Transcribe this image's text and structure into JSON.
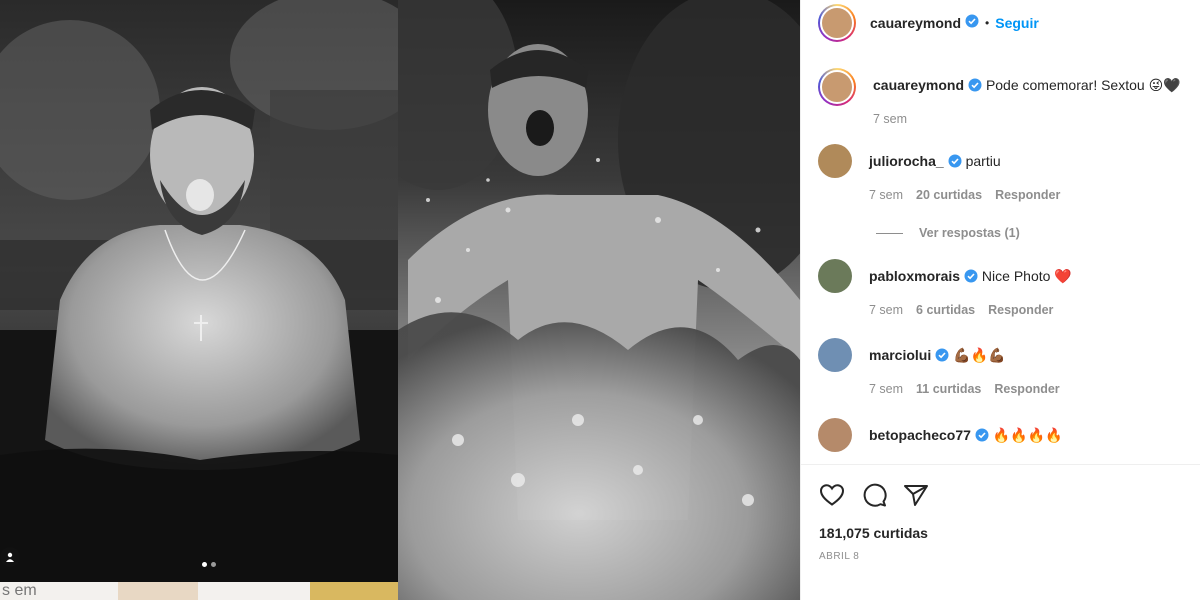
{
  "post": {
    "author": "cauareymond",
    "follow_label": "Seguir",
    "separator": "•",
    "carousel_active_index": 0,
    "carousel_count": 2,
    "likes": "181,075 curtidas",
    "date": "ABRIL 8"
  },
  "caption": {
    "username": "cauareymond",
    "text": "Pode comemorar! Sextou 😜🖤",
    "time": "7 sem"
  },
  "comments": [
    {
      "username": "juliorocha_",
      "text": "partiu",
      "time": "7 sem",
      "likes": "20 curtidas",
      "reply_label": "Responder",
      "avatar_color": "#b08a5a"
    },
    {
      "username": "pabloxmorais",
      "text": "Nice Photo ❤️",
      "time": "7 sem",
      "likes": "6 curtidas",
      "reply_label": "Responder",
      "avatar_color": "#6b7a5a"
    },
    {
      "username": "marciolui",
      "text": "💪🏾🔥💪🏾",
      "time": "7 sem",
      "likes": "11 curtidas",
      "reply_label": "Responder",
      "avatar_color": "#6f8fb3"
    },
    {
      "username": "betopacheco77",
      "text": "🔥🔥🔥🔥",
      "avatar_color": "#b58a6a"
    }
  ],
  "view_replies": "Ver respostas (1)",
  "strip": {
    "text": "s em"
  },
  "icons": [
    "like-heart-icon",
    "comment-icon",
    "share-icon",
    "user-tag-icon",
    "verified-badge-icon"
  ],
  "colors": {
    "accent": "#0095f6",
    "text": "#262626",
    "muted": "#8e8e8e",
    "verified": "#3897f0"
  }
}
